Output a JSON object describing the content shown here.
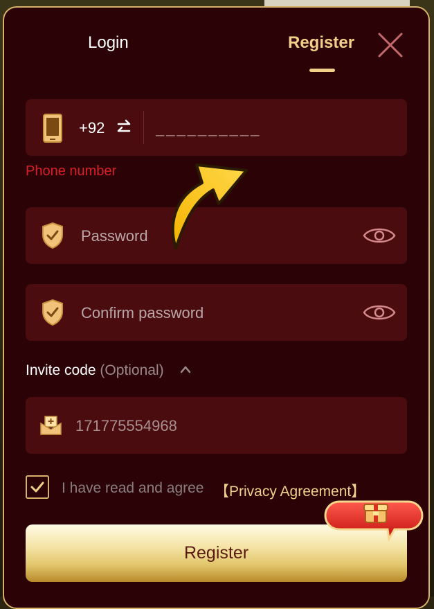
{
  "tabs": {
    "login_label": "Login",
    "register_label": "Register"
  },
  "phone": {
    "country_code": "+92",
    "placeholder": "__________",
    "error": "Phone number"
  },
  "password": {
    "placeholder": "Password"
  },
  "confirm_password": {
    "placeholder": "Confirm password"
  },
  "invite": {
    "label": "Invite code",
    "optional": "(Optional)",
    "value": "171775554968"
  },
  "agreement": {
    "checked": true,
    "text": "I have read and agree",
    "link": "【Privacy Agreement】"
  },
  "submit": {
    "label": "Register"
  },
  "colors": {
    "panel_bg": "#2b0306",
    "field_bg": "#4b0c10",
    "accent_gold": "#f2cf8a",
    "error_red": "#d91f2a"
  },
  "icons": [
    "phone-icon",
    "swap-icon",
    "shield-icon",
    "eye-icon",
    "close-icon",
    "invite-mail-icon",
    "chevron-up-icon",
    "check-icon",
    "gift-icon",
    "arrow-pointer-icon"
  ]
}
